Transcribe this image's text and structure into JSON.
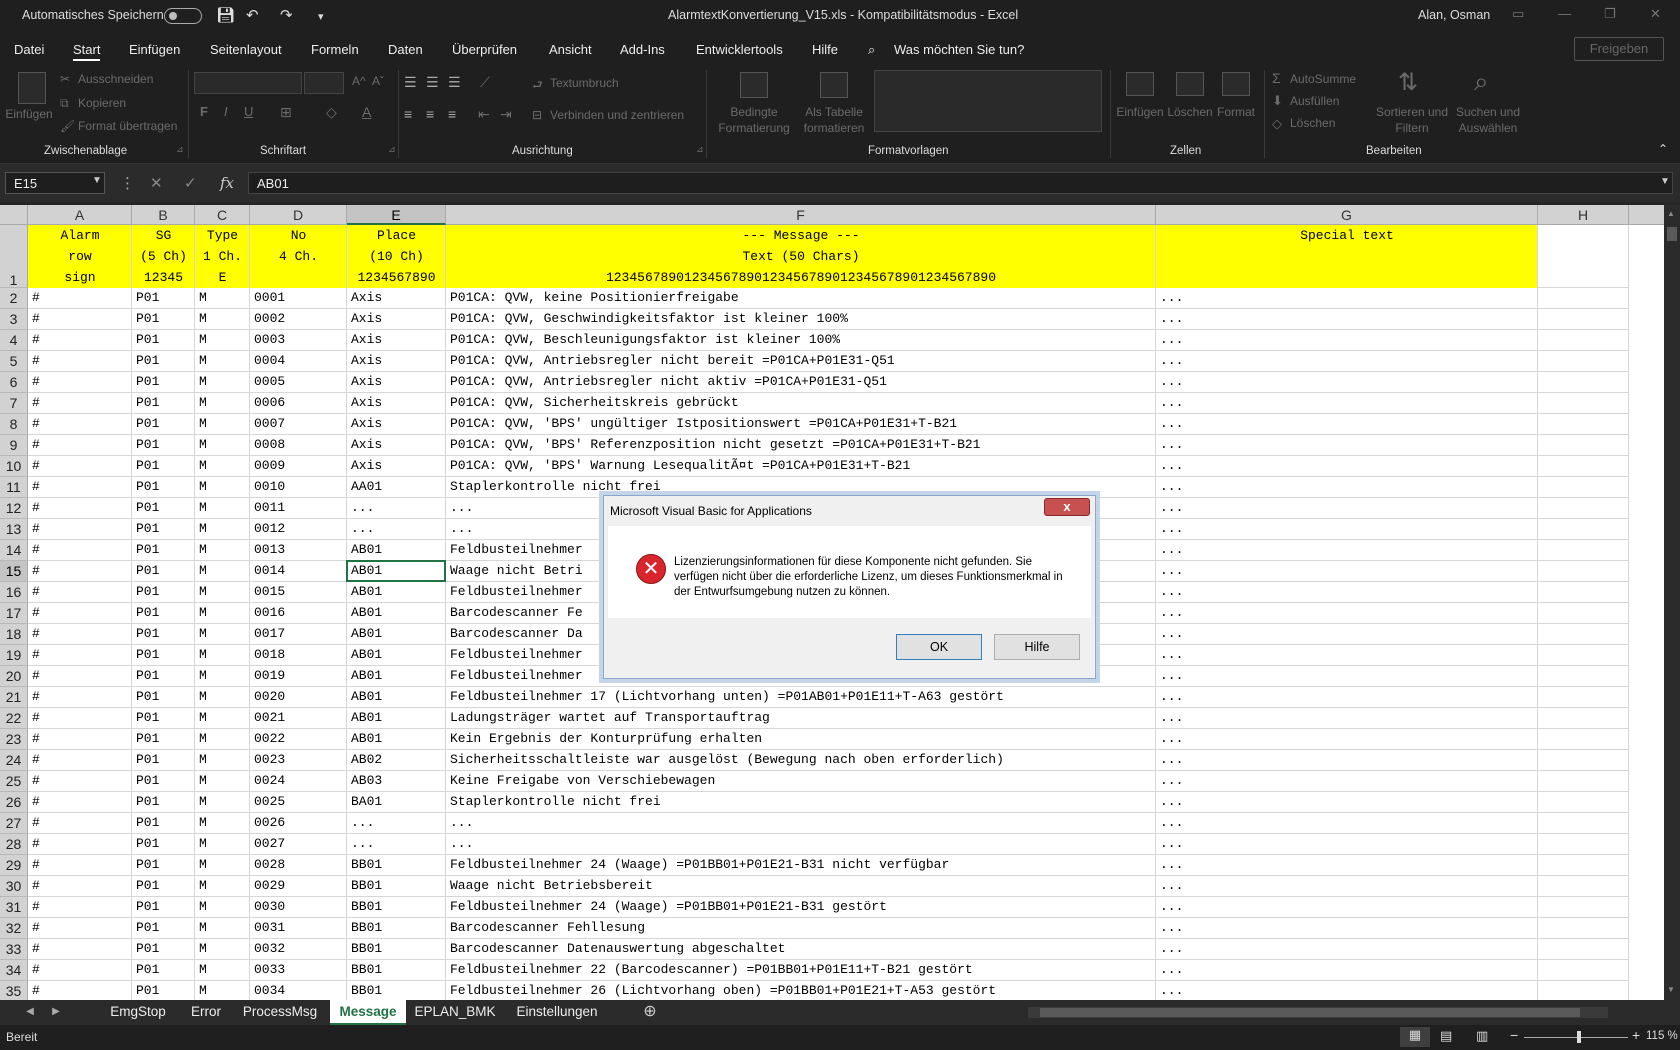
{
  "titlebar": {
    "autosave_label": "Automatisches Speichern",
    "document_title": "AlarmtextKonvertierung_V15.xls  -  Kompatibilitätsmodus  -  Excel",
    "user": "Alan, Osman"
  },
  "menu": {
    "items": [
      "Datei",
      "Start",
      "Einfügen",
      "Seitenlayout",
      "Formeln",
      "Daten",
      "Überprüfen",
      "Ansicht",
      "Add-Ins",
      "Entwicklertools",
      "Hilfe"
    ],
    "search": "Was möchten Sie tun?",
    "share": "Freigeben"
  },
  "ribbon": {
    "clipboard": {
      "paste": "Einfügen",
      "cut": "Ausschneiden",
      "copy": "Kopieren",
      "format_painter": "Format übertragen",
      "label": "Zwischenablage"
    },
    "font": {
      "bold": "F",
      "italic": "I",
      "underline": "U",
      "label": "Schriftart",
      "grow": "A^",
      "shrink": "Aˇ",
      "color": "A"
    },
    "alignment": {
      "wrap": "Textumbruch",
      "merge": "Verbinden und zentrieren",
      "label": "Ausrichtung"
    },
    "styles": {
      "conditional": "Bedingte Formatierung",
      "table": "Als Tabelle formatieren",
      "label": "Formatvorlagen"
    },
    "cells": {
      "insert": "Einfügen",
      "delete": "Löschen",
      "format": "Format",
      "label": "Zellen"
    },
    "editing": {
      "autosum": "AutoSumme",
      "fill": "Ausfüllen",
      "clear": "Löschen",
      "sort": "Sortieren und Filtern",
      "find": "Suchen und Auswählen",
      "label": "Bearbeiten"
    }
  },
  "formula_bar": {
    "name_box": "E15",
    "fx": "fx",
    "value": "AB01"
  },
  "columns": [
    "A",
    "B",
    "C",
    "D",
    "E",
    "F",
    "G",
    "H"
  ],
  "header_row": {
    "a": "Alarm\nrow\nsign",
    "b": "SG\n(5 Ch)\n12345",
    "c": "Type\n1 Ch.\nE",
    "d": "No\n4 Ch.\n",
    "e": "Place\n(10 Ch)\n1234567890",
    "f": "--- Message ---\nText (50 Chars)\n12345678901234567890123456789012345678901234567890",
    "g": "Special text\n\n"
  },
  "rows": [
    [
      "2",
      "#",
      "P01",
      "M",
      "0001",
      "Axis",
      "P01CA: QVW, keine Positionierfreigabe",
      "..."
    ],
    [
      "3",
      "#",
      "P01",
      "M",
      "0002",
      "Axis",
      "P01CA: QVW, Geschwindigkeitsfaktor ist kleiner 100%",
      "..."
    ],
    [
      "4",
      "#",
      "P01",
      "M",
      "0003",
      "Axis",
      "P01CA: QVW, Beschleunigungsfaktor ist kleiner 100%",
      "..."
    ],
    [
      "5",
      "#",
      "P01",
      "M",
      "0004",
      "Axis",
      "P01CA: QVW, Antriebsregler nicht bereit =P01CA+P01E31-Q51",
      "..."
    ],
    [
      "6",
      "#",
      "P01",
      "M",
      "0005",
      "Axis",
      "P01CA: QVW, Antriebsregler nicht aktiv =P01CA+P01E31-Q51",
      "..."
    ],
    [
      "7",
      "#",
      "P01",
      "M",
      "0006",
      "Axis",
      "P01CA: QVW, Sicherheitskreis gebrückt",
      "..."
    ],
    [
      "8",
      "#",
      "P01",
      "M",
      "0007",
      "Axis",
      "P01CA: QVW, 'BPS' ungültiger Istpositionswert =P01CA+P01E31+T-B21",
      "..."
    ],
    [
      "9",
      "#",
      "P01",
      "M",
      "0008",
      "Axis",
      "P01CA: QVW, 'BPS' Referenzposition nicht gesetzt =P01CA+P01E31+T-B21",
      "..."
    ],
    [
      "10",
      "#",
      "P01",
      "M",
      "0009",
      "Axis",
      "P01CA: QVW, 'BPS' Warnung LesequalitÃ¤t =P01CA+P01E31+T-B21",
      "..."
    ],
    [
      "11",
      "#",
      "P01",
      "M",
      "0010",
      "AA01",
      "Staplerkontrolle nicht frei",
      "..."
    ],
    [
      "12",
      "#",
      "P01",
      "M",
      "0011",
      "...",
      "...",
      "..."
    ],
    [
      "13",
      "#",
      "P01",
      "M",
      "0012",
      "...",
      "...",
      "..."
    ],
    [
      "14",
      "#",
      "P01",
      "M",
      "0013",
      "AB01",
      "Feldbusteilnehmer",
      "..."
    ],
    [
      "15",
      "#",
      "P01",
      "M",
      "0014",
      "AB01",
      "Waage nicht Betri",
      "..."
    ],
    [
      "16",
      "#",
      "P01",
      "M",
      "0015",
      "AB01",
      "Feldbusteilnehmer",
      "..."
    ],
    [
      "17",
      "#",
      "P01",
      "M",
      "0016",
      "AB01",
      "Barcodescanner Fe",
      "..."
    ],
    [
      "18",
      "#",
      "P01",
      "M",
      "0017",
      "AB01",
      "Barcodescanner Da",
      "..."
    ],
    [
      "19",
      "#",
      "P01",
      "M",
      "0018",
      "AB01",
      "Feldbusteilnehmer",
      "..."
    ],
    [
      "20",
      "#",
      "P01",
      "M",
      "0019",
      "AB01",
      "Feldbusteilnehmer",
      "..."
    ],
    [
      "21",
      "#",
      "P01",
      "M",
      "0020",
      "AB01",
      "Feldbusteilnehmer 17 (Lichtvorhang unten) =P01AB01+P01E11+T-A63 gestört",
      "..."
    ],
    [
      "22",
      "#",
      "P01",
      "M",
      "0021",
      "AB01",
      "Ladungsträger wartet auf Transportauftrag",
      "..."
    ],
    [
      "23",
      "#",
      "P01",
      "M",
      "0022",
      "AB01",
      "Kein Ergebnis der Konturprüfung erhalten",
      "..."
    ],
    [
      "24",
      "#",
      "P01",
      "M",
      "0023",
      "AB02",
      "Sicherheitsschaltleiste war ausgelöst (Bewegung nach oben erforderlich)",
      "..."
    ],
    [
      "25",
      "#",
      "P01",
      "M",
      "0024",
      "AB03",
      "Keine Freigabe von Verschiebewagen",
      "..."
    ],
    [
      "26",
      "#",
      "P01",
      "M",
      "0025",
      "BA01",
      "Staplerkontrolle nicht frei",
      "..."
    ],
    [
      "27",
      "#",
      "P01",
      "M",
      "0026",
      "...",
      "...",
      "..."
    ],
    [
      "28",
      "#",
      "P01",
      "M",
      "0027",
      "...",
      "...",
      "..."
    ],
    [
      "29",
      "#",
      "P01",
      "M",
      "0028",
      "BB01",
      "Feldbusteilnehmer 24 (Waage) =P01BB01+P01E21-B31 nicht verfügbar",
      "..."
    ],
    [
      "30",
      "#",
      "P01",
      "M",
      "0029",
      "BB01",
      "Waage nicht Betriebsbereit",
      "..."
    ],
    [
      "31",
      "#",
      "P01",
      "M",
      "0030",
      "BB01",
      "Feldbusteilnehmer 24 (Waage) =P01BB01+P01E21-B31 gestört",
      "..."
    ],
    [
      "32",
      "#",
      "P01",
      "M",
      "0031",
      "BB01",
      "Barcodescanner Fehllesung",
      "..."
    ],
    [
      "33",
      "#",
      "P01",
      "M",
      "0032",
      "BB01",
      "Barcodescanner Datenauswertung abgeschaltet",
      "..."
    ],
    [
      "34",
      "#",
      "P01",
      "M",
      "0033",
      "BB01",
      "Feldbusteilnehmer 22 (Barcodescanner) =P01BB01+P01E11+T-B21 gestört",
      "..."
    ],
    [
      "35",
      "#",
      "P01",
      "M",
      "0034",
      "BB01",
      "Feldbusteilnehmer 26 (Lichtvorhang oben) =P01BB01+P01E21+T-A53 gestört",
      "..."
    ]
  ],
  "sheets": [
    "EmgStop",
    "Error",
    "ProcessMsg",
    "Message",
    "EPLAN_BMK",
    "Einstellungen"
  ],
  "active_sheet": "Message",
  "status": {
    "ready": "Bereit",
    "zoom": "115 %"
  },
  "dialog": {
    "title": "Microsoft Visual Basic for Applications",
    "close": "x",
    "message": "Lizenzierungsinformationen für diese Komponente nicht gefunden. Sie verfügen nicht über die erforderliche Lizenz, um dieses Funktionsmerkmal in der Entwurfsumgebung nutzen zu können.",
    "ok": "OK",
    "help": "Hilfe"
  },
  "colors": {
    "header_fill": "#ffff00",
    "accent": "#217346",
    "dialog_error": "#d9262c"
  }
}
